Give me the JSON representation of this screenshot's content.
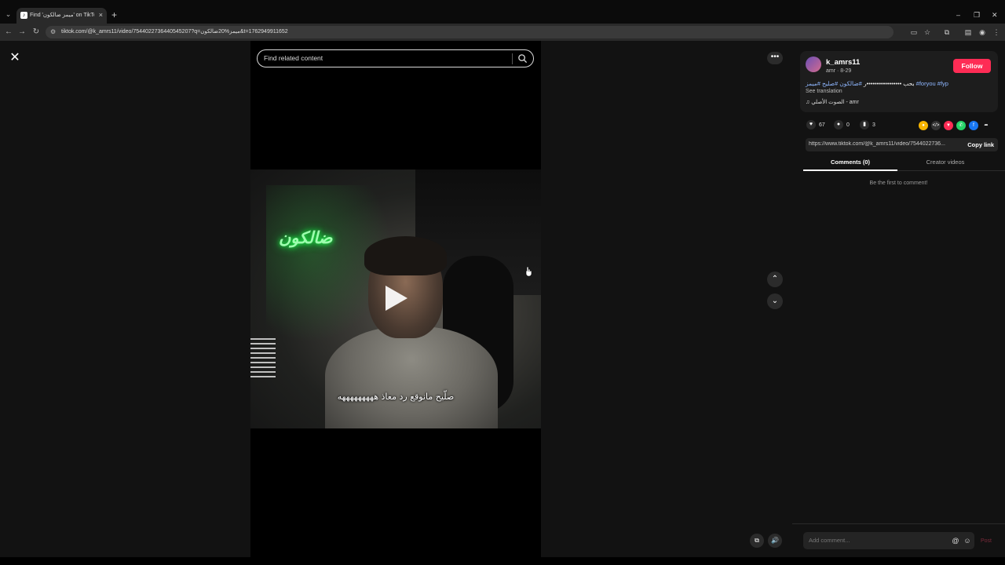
{
  "browser": {
    "tab_title": "Find 'ميمز ضالكون' on TikTok | Ti",
    "tab_close": "×",
    "new_tab": "+",
    "url": "tiktok.com/@k_amrs11/video/7544022736440545207?q=ميمز%20ضالكون&t=1762949911652",
    "win_minimize": "–",
    "win_restore": "❐",
    "win_close": "✕"
  },
  "search": {
    "placeholder": "Find related content"
  },
  "video": {
    "caption": "صلّيح مانوقع رد معاذ هههههههههه",
    "neon_sign": "ضالكون"
  },
  "author": {
    "username": "k_amrs11",
    "subline": "amr · 8-29",
    "follow_label": "Follow",
    "description_text": "بحب •••••••••••••••••ر",
    "description_tags": "#ضالكون #صليح #ميمز #foryou #fyp",
    "see_translation": "See translation",
    "music": "♫  الصوت الأصلي - amr"
  },
  "stats": {
    "likes": "67",
    "comments": "0",
    "saves": "3"
  },
  "share": {
    "link": "https://www.tiktok.com/@k_amrs11/video/7544022736...",
    "copy_label": "Copy link"
  },
  "tabs": {
    "comments_label": "Comments (0)",
    "creator_label": "Creator videos"
  },
  "comments": {
    "empty_text": "Be the first to comment!",
    "placeholder": "Add comment...",
    "post_label": "Post"
  },
  "icons": {
    "close": "✕",
    "more": "•••",
    "up": "⌃",
    "down": "⌄"
  },
  "colors": {
    "follow": "#fe2c55",
    "tag": "#8fb7ff"
  }
}
